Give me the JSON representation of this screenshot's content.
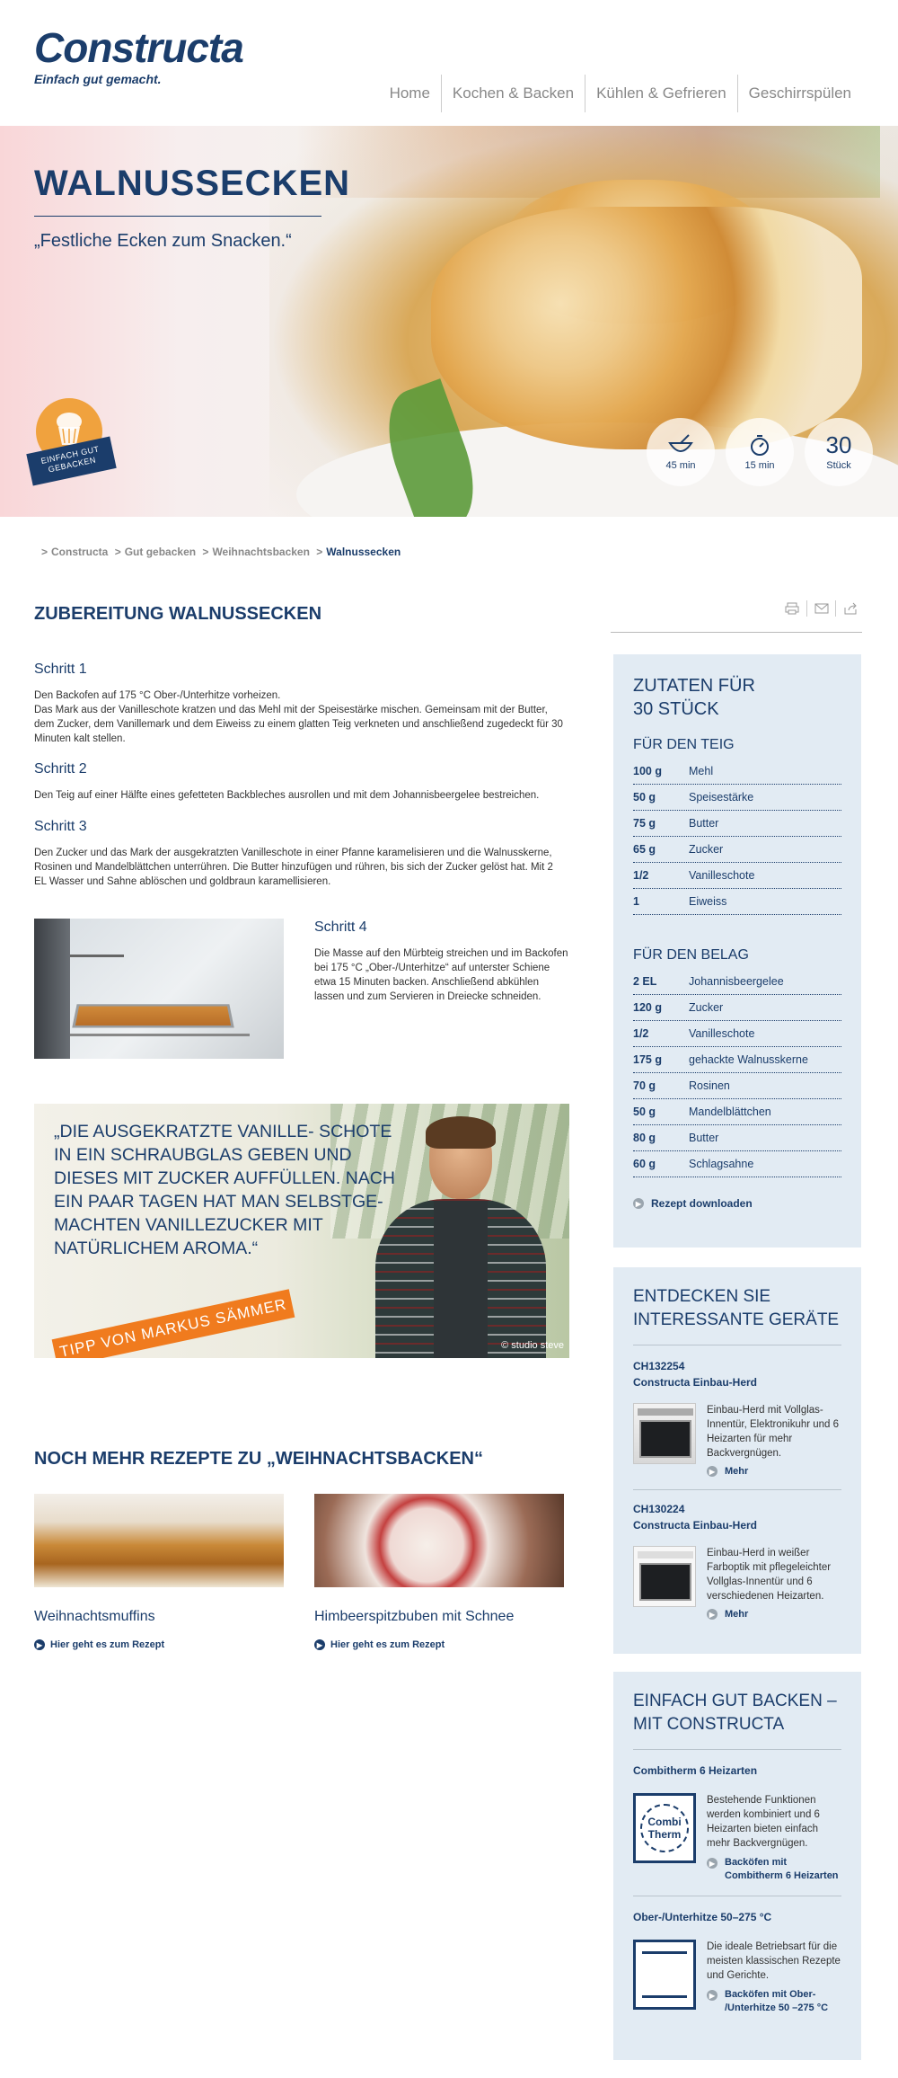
{
  "brand": {
    "name": "Constructa",
    "tagline": "Einfach gut gemacht."
  },
  "nav": [
    "Home",
    "Kochen & Backen",
    "Kühlen & Gefrieren",
    "Geschirrspülen"
  ],
  "hero": {
    "title": "WALNUSSECKEN",
    "subtitle": "„Festliche Ecken zum Snacken.“",
    "badge": "EINFACH GUT GEBACKEN",
    "stats": [
      {
        "icon": "bowl-icon",
        "value": "45 min"
      },
      {
        "icon": "stopwatch-icon",
        "value": "15 min"
      },
      {
        "number": "30",
        "value": "Stück"
      }
    ]
  },
  "breadcrumb": [
    "Constructa",
    "Gut gebacken",
    "Weihnachtsbacken",
    "Walnussecken"
  ],
  "prep": {
    "title": "ZUBEREITUNG WALNUSSECKEN",
    "steps": [
      {
        "title": "Schritt 1",
        "text": "Den Backofen auf 175 °C Ober-/Unterhitze vorheizen.\nDas Mark aus der Vanilleschote kratzen und das Mehl mit der Speisestärke mischen. Gemeinsam mit der Butter, dem Zucker, dem Vanillemark und dem Eiweiss zu einem glatten Teig verkneten und anschließend zugedeckt für 30 Minuten kalt stellen."
      },
      {
        "title": "Schritt 2",
        "text": "Den Teig auf einer Hälfte eines gefetteten Backbleches ausrollen und mit dem Johannisbeergelee bestreichen."
      },
      {
        "title": "Schritt 3",
        "text": "Den Zucker und das Mark der ausgekratzten Vanilleschote in einer Pfanne karamelisieren und die Walnusskerne, Rosinen und Mandelblättchen unterrühren. Die Butter hinzufügen und rühren, bis sich der Zucker gelöst hat. Mit 2 EL Wasser und Sahne ablöschen und goldbraun karamellisieren."
      },
      {
        "title": "Schritt 4",
        "text": "Die Masse auf den Mürbteig streichen und im Backofen bei 175 °C „Ober-/Unterhitze“ auf unterster Schiene etwa 15 Minuten backen. Anschließend abkühlen lassen und zum Servieren in Dreiecke schneiden."
      }
    ]
  },
  "tip": {
    "quote": "„DIE AUSGEKRATZTE VANILLE- SCHOTE IN EIN SCHRAUBGLAS GEBEN UND DIESES MIT ZUCKER AUFFÜLLEN. NACH EIN PAAR TAGEN HAT MAN SELBSTGE- MACHTEN VANILLEZUCKER MIT NATÜRLICHEM AROMA.“",
    "ribbon": "TIPP VON MARKUS SÄMMER",
    "credit": "© studio steve"
  },
  "more": {
    "title": "NOCH MEHR REZEPTE ZU „WEIHNACHTSBACKEN“",
    "cards": [
      {
        "title": "Weihnachtsmuffins",
        "link": "Hier geht es zum Rezept"
      },
      {
        "title": "Himbeerspitzbuben mit Schnee",
        "link": "Hier geht es zum Rezept"
      }
    ]
  },
  "ingredients": {
    "title": "ZUTATEN FÜR",
    "title2": "30 STÜCK",
    "groups": [
      {
        "name": "FÜR DEN TEIG",
        "items": [
          {
            "q": "100 g",
            "n": "Mehl"
          },
          {
            "q": "50 g",
            "n": "Speisestärke"
          },
          {
            "q": "75 g",
            "n": "Butter"
          },
          {
            "q": "65 g",
            "n": "Zucker"
          },
          {
            "q": "1/2",
            "n": "Vanilleschote"
          },
          {
            "q": "1",
            "n": "Eiweiss"
          }
        ]
      },
      {
        "name": "FÜR DEN BELAG",
        "items": [
          {
            "q": "2 EL",
            "n": "Johannisbeergelee"
          },
          {
            "q": "120 g",
            "n": "Zucker"
          },
          {
            "q": "1/2",
            "n": "Vanilleschote"
          },
          {
            "q": "175 g",
            "n": "gehackte Walnusskerne"
          },
          {
            "q": "70 g",
            "n": "Rosinen"
          },
          {
            "q": "50 g",
            "n": "Mandelblättchen"
          },
          {
            "q": "80 g",
            "n": "Butter"
          },
          {
            "q": "60 g",
            "n": "Schlagsahne"
          }
        ]
      }
    ],
    "download": "Rezept downloaden"
  },
  "devices": {
    "title": "ENTDECKEN SIE INTERESSANTE GERÄTE",
    "items": [
      {
        "id": "CH132254",
        "name": "Constructa Einbau-Herd",
        "text": "Einbau-Herd mit Vollglas-Innentür, Elektronikuhr und 6 Heizarten für mehr Backvergnügen.",
        "link": "Mehr"
      },
      {
        "id": "CH130224",
        "name": "Constructa Einbau-Herd",
        "text": "Einbau-Herd in weißer Farboptik mit pflegeleichter Vollglas-Innentür und 6 verschiedenen Heizarten.",
        "link": "Mehr"
      }
    ]
  },
  "baking": {
    "title": "EINFACH GUT BACKEN – MIT CONSTRUCTA",
    "items": [
      {
        "title": "Combitherm 6 Heizarten",
        "icon_text": "Combi Therm",
        "text": "Bestehende Funktionen werden kombiniert und 6 Heizarten bieten einfach mehr Backvergnügen.",
        "link": "Backöfen mit Combitherm 6 Heizarten"
      },
      {
        "title": "Ober-/Unterhitze 50–275 °C",
        "text": "Die ideale Betriebsart für die meisten klassischen Rezepte und Gerichte.",
        "link": "Backöfen mit Ober- /Unterhitze 50 –275 °C"
      }
    ]
  },
  "colors": {
    "brand_blue": "#1b3d6b",
    "orange": "#f07b1e",
    "box_bg": "#e2ebf3"
  }
}
